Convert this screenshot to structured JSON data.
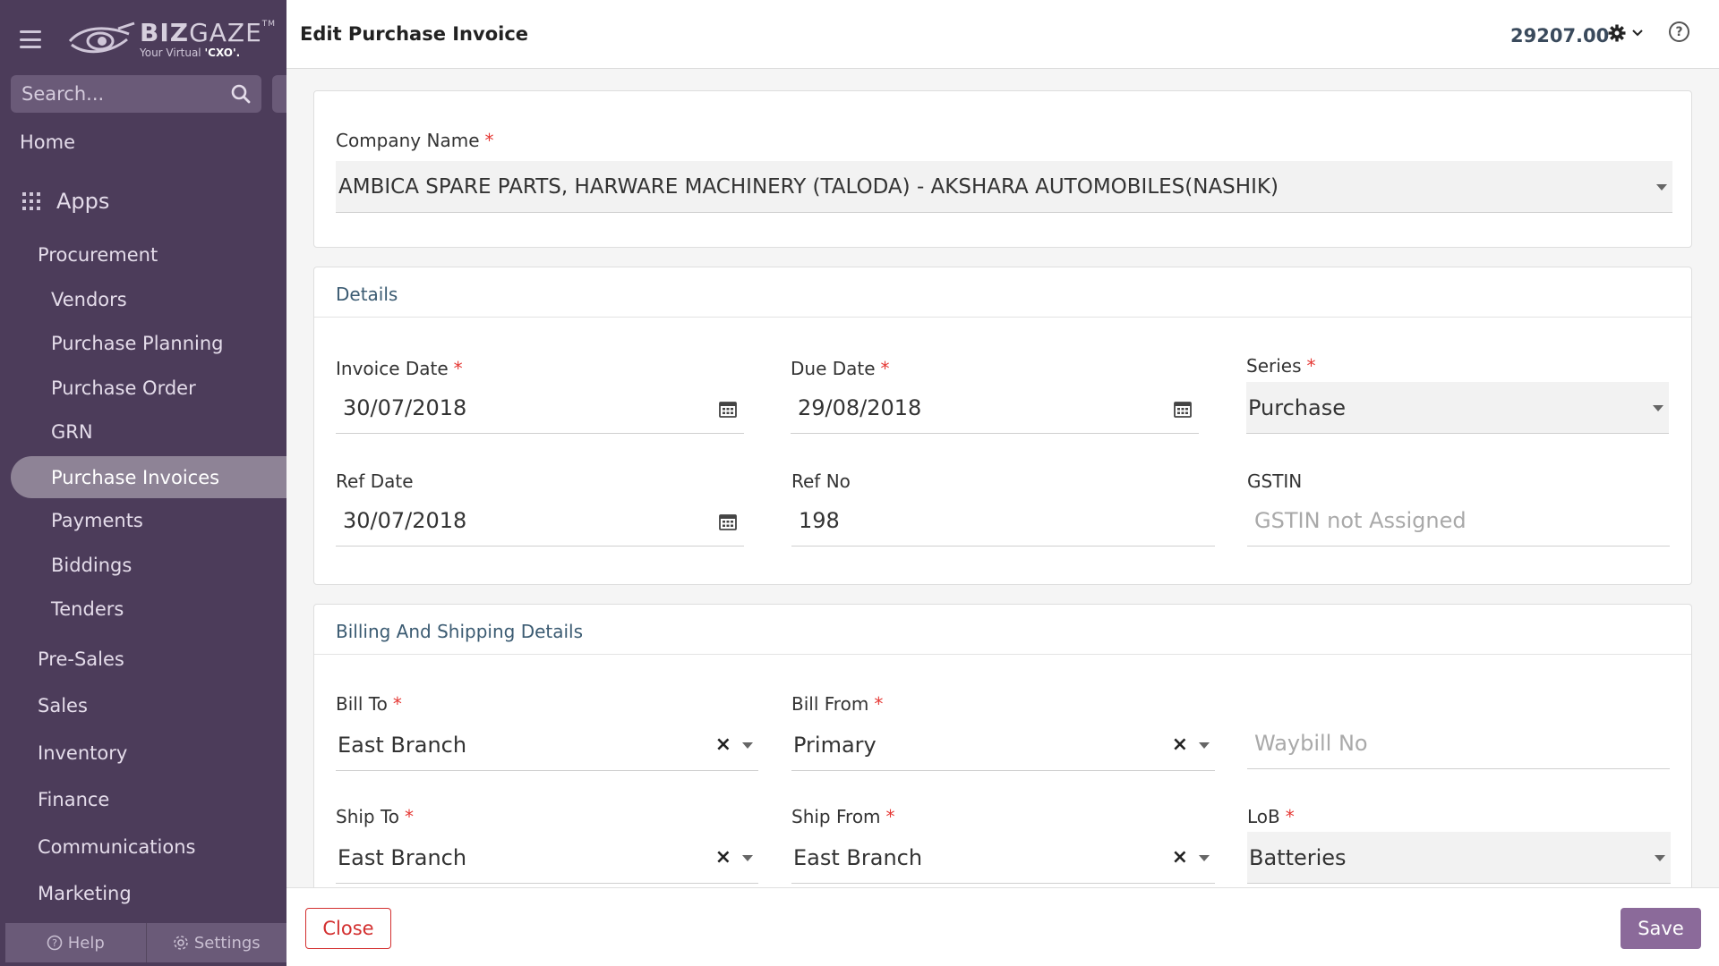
{
  "sidebar": {
    "brand": {
      "name_bold": "BIZ",
      "name_light": "GAZE",
      "tm": "TM",
      "tagline_pre": "Your Virtual ",
      "tagline_bold": "'CXO'."
    },
    "search_placeholder": "Search...",
    "home": "Home",
    "apps": "Apps",
    "procurement": "Procurement",
    "procurement_items": [
      "Vendors",
      "Purchase Planning",
      "Purchase Order",
      "GRN",
      "Purchase Invoices",
      "Payments",
      "Biddings",
      "Tenders"
    ],
    "modules": [
      "Pre-Sales",
      "Sales",
      "Inventory",
      "Finance",
      "Communications",
      "Marketing"
    ],
    "footer": {
      "help": "Help",
      "settings": "Settings"
    }
  },
  "header": {
    "title": "Edit Purchase Invoice",
    "amount": "29207.00"
  },
  "company": {
    "label": "Company Name",
    "value": "AMBICA SPARE PARTS, HARWARE MACHINERY (TALODA) - AKSHARA AUTOMOBILES(NASHIK)"
  },
  "details": {
    "title": "Details",
    "invoice_date": {
      "label": "Invoice Date",
      "value": "30/07/2018"
    },
    "due_date": {
      "label": "Due Date",
      "value": "29/08/2018"
    },
    "series": {
      "label": "Series",
      "value": "Purchase"
    },
    "ref_date": {
      "label": "Ref Date",
      "value": "30/07/2018"
    },
    "ref_no": {
      "label": "Ref No",
      "value": "198"
    },
    "gstin": {
      "label": "GSTIN",
      "placeholder": "GSTIN not Assigned"
    }
  },
  "billing": {
    "title": "Billing And Shipping Details",
    "bill_to": {
      "label": "Bill To",
      "value": "East Branch"
    },
    "bill_from": {
      "label": "Bill From",
      "value": "Primary"
    },
    "waybill": {
      "placeholder": "Waybill No"
    },
    "ship_to": {
      "label": "Ship To",
      "value": "East Branch"
    },
    "ship_from": {
      "label": "Ship From",
      "value": "East Branch"
    },
    "lob": {
      "label": "LoB",
      "value": "Batteries"
    }
  },
  "actions": {
    "close": "Close",
    "save": "Save"
  },
  "colors": {
    "sidebar": "#4c3c5a",
    "accent": "#8b6a9a",
    "danger": "#d32f2f",
    "required": "#e53935"
  }
}
